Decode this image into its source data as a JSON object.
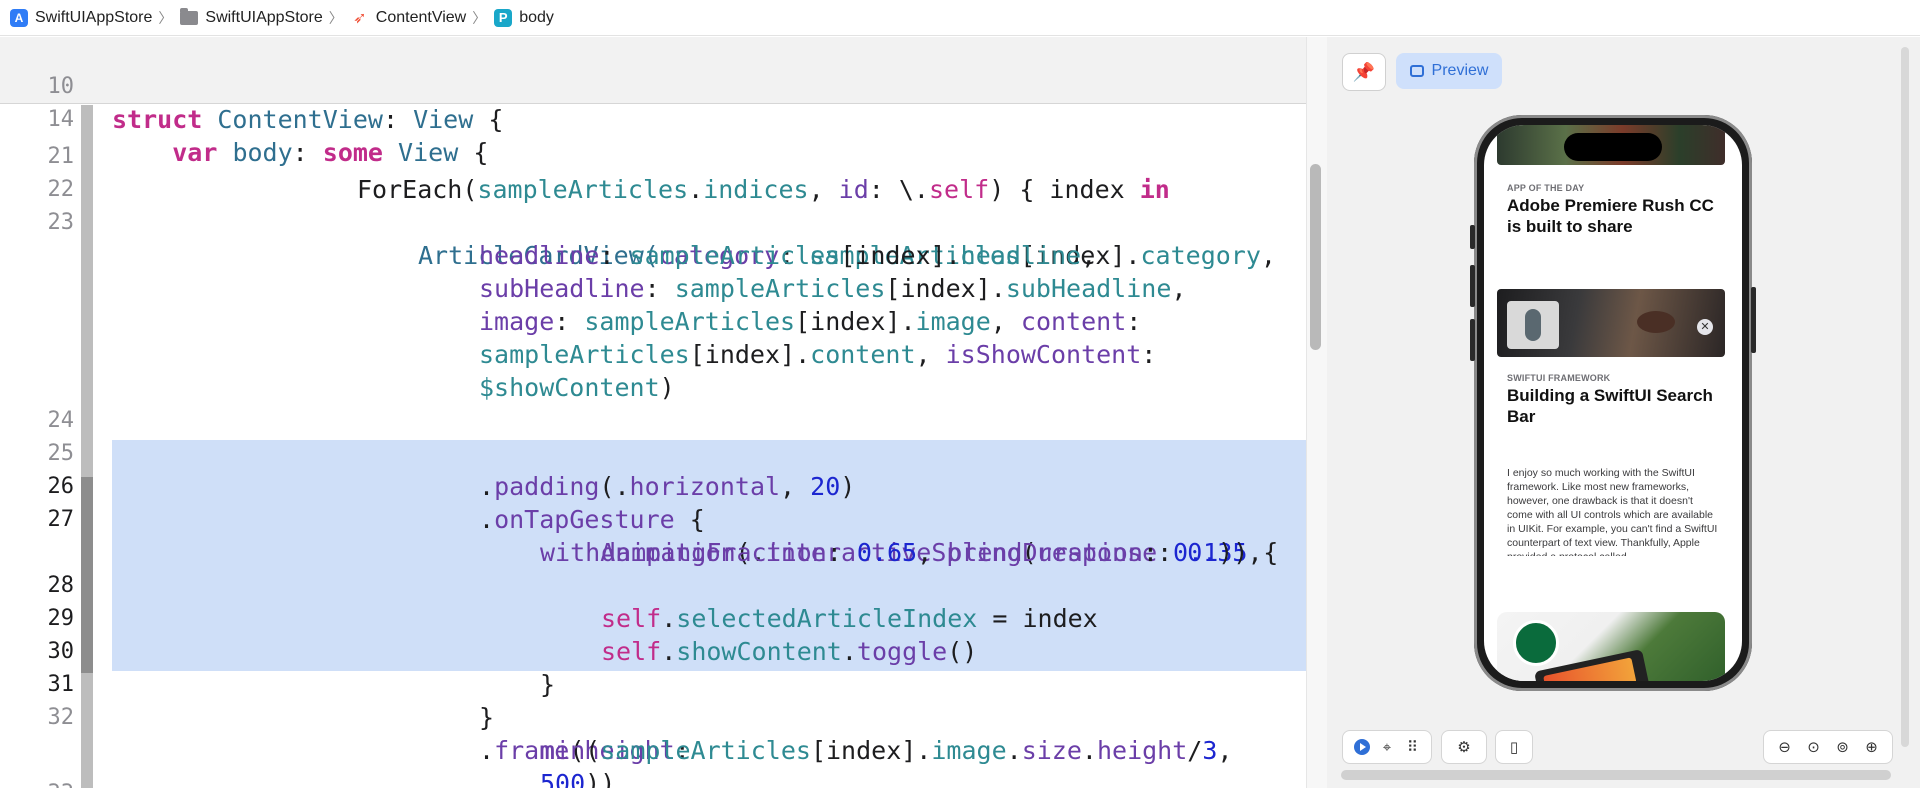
{
  "breadcrumb": {
    "items": [
      {
        "label": "SwiftUIAppStore",
        "icon": "app-project-icon"
      },
      {
        "label": "SwiftUIAppStore",
        "icon": "folder-icon"
      },
      {
        "label": "ContentView",
        "icon": "swift-file-icon"
      },
      {
        "label": "body",
        "icon": "property-icon",
        "icon_letter": "P"
      }
    ],
    "separator": "〉"
  },
  "editor": {
    "sticky_lines": [
      {
        "num": "10",
        "text": "struct ContentView: View {"
      },
      {
        "num": "14",
        "text": "    var body: some View {"
      }
    ],
    "line_numbers": [
      "21",
      "22",
      "23",
      "24",
      "25",
      "26",
      "27",
      "28",
      "29",
      "30",
      "31",
      "32",
      "33"
    ],
    "code": {
      "l21": {
        "a": "ForEach(",
        "b": "sampleArticles",
        "c": ".",
        "d": "indices",
        "e": ", ",
        "f": "id",
        "g": ": \\.",
        "h": "self",
        "i": ") { index ",
        "j": "in"
      },
      "l23": {
        "a": "ArticleCardView(",
        "b": "category",
        "c": ": ",
        "d": "sampleArticles",
        "e": "[index].",
        "f": "category",
        "g": ","
      },
      "l23b": {
        "a": "headline",
        "b": ": ",
        "c": "sampleArticles",
        "d": "[index].",
        "e": "headline",
        "f": ","
      },
      "l23c": {
        "a": "subHeadline",
        "b": ": ",
        "c": "sampleArticles",
        "d": "[index].",
        "e": "subHeadline",
        "f": ","
      },
      "l23d": {
        "a": "image",
        "b": ": ",
        "c": "sampleArticles",
        "d": "[index].",
        "e": "image",
        "f": ", ",
        "g": "content",
        "h": ":"
      },
      "l23e": {
        "a": "sampleArticles",
        "b": "[index].",
        "c": "content",
        "d": ", ",
        "e": "isShowContent",
        "f": ":"
      },
      "l23f": {
        "a": "$showContent",
        "b": ")"
      },
      "l25": {
        "a": ".",
        "b": "padding",
        "c": "(.",
        "d": "horizontal",
        "e": ", ",
        "f": "20",
        "g": ")"
      },
      "l26": {
        "a": ".",
        "b": "onTapGesture",
        "c": " {"
      },
      "l27": {
        "a": "withAnimation",
        "b": "(.",
        "c": "interactiveSpring",
        "d": "(",
        "e": "response",
        "f": ": ",
        "g": "0.35",
        "h": ","
      },
      "l27b": {
        "a": "dampingFraction",
        "b": ": ",
        "c": "0.65",
        "d": ", ",
        "e": "blendDuration",
        "f": ": ",
        "g": "0.1",
        "h": ")) {"
      },
      "l28": {
        "a": "self",
        "b": ".",
        "c": "selectedArticleIndex",
        "d": " = index"
      },
      "l29": {
        "a": "self",
        "b": ".",
        "c": "showContent",
        "d": ".",
        "e": "toggle",
        "f": "()"
      },
      "l30": {
        "a": "}"
      },
      "l31": {
        "a": "}"
      },
      "l32": {
        "a": ".",
        "b": "frame",
        "c": "(",
        "d": "height",
        "e": ":"
      },
      "l32b": {
        "a": "min",
        "b": "(",
        "c": "sampleArticles",
        "d": "[index].",
        "e": "image",
        "f": ".",
        "g": "size",
        "h": ".",
        "i": "height",
        "j": "/",
        "k": "3",
        "l": ","
      },
      "l32c": {
        "a": "500",
        "b": "))"
      }
    }
  },
  "preview": {
    "pin_icon": "pin-icon",
    "preview_label": "Preview",
    "cards": [
      {
        "category": "APP OF THE DAY",
        "headline": "Adobe Premiere Rush CC is built to share"
      },
      {
        "category": "SWIFTUI FRAMEWORK",
        "headline": "Building a SwiftUI Search Bar",
        "content": "I enjoy so much working with the SwiftUI framework. Like most new frameworks, however, one drawback is that it doesn't come with all UI controls which are available in UIKit. For example, you can't find a SwiftUI counterpart of text view. Thankfully, Apple provided a protocol called UIViewRepresentable that allows"
      }
    ],
    "close_glyph": "✕",
    "toolbar": {
      "left_icons": [
        "live-preview-icon",
        "selectable-icon",
        "variants-grid-icon"
      ],
      "mid_icons": [
        "device-settings-icon"
      ],
      "device_icons": [
        "device-icon"
      ],
      "zoom_icons": [
        "zoom-out-icon",
        "zoom-fit-icon",
        "zoom-100-icon",
        "zoom-in-icon"
      ]
    },
    "colors": {
      "accent": "#2f6fd6",
      "selection": "#cfdff8",
      "preview_button_bg": "#cfe0fb"
    }
  }
}
